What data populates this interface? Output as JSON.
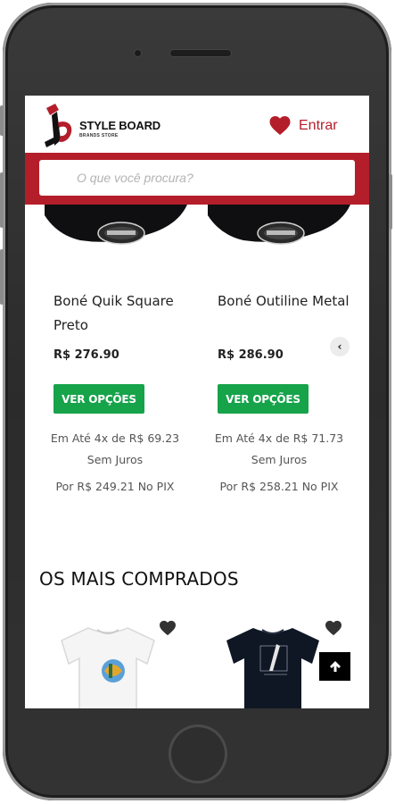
{
  "header": {
    "logo_name": "STYLE BOARD",
    "logo_sub": "BRANDS STORE",
    "login_label": "Entrar"
  },
  "search": {
    "placeholder": "O que você procura?"
  },
  "products": [
    {
      "name": "Boné Quik Square Preto",
      "price": "R$ 276.90",
      "cta": "VER OPÇÕES",
      "installments": "Em Até 4x de R$ 69.23 Sem Juros",
      "pix": "Por R$ 249.21 No PIX"
    },
    {
      "name": "Boné Outiline Metal",
      "price": "R$ 286.90",
      "cta": "VER OPÇÕES",
      "installments": "Em Até 4x de R$ 71.73 Sem Juros",
      "pix": "Por R$ 258.21 No PIX"
    }
  ],
  "carousel": {
    "prev_symbol": "‹"
  },
  "best_sellers": {
    "title": "OS MAIS COMPRADOS"
  },
  "icons": {
    "heart": "heart-icon",
    "back_to_top": "arrow-up-icon",
    "shirt": "t-shirt-icon"
  },
  "colors": {
    "brand_red": "#b41e2b",
    "button_green": "#16a34a"
  }
}
